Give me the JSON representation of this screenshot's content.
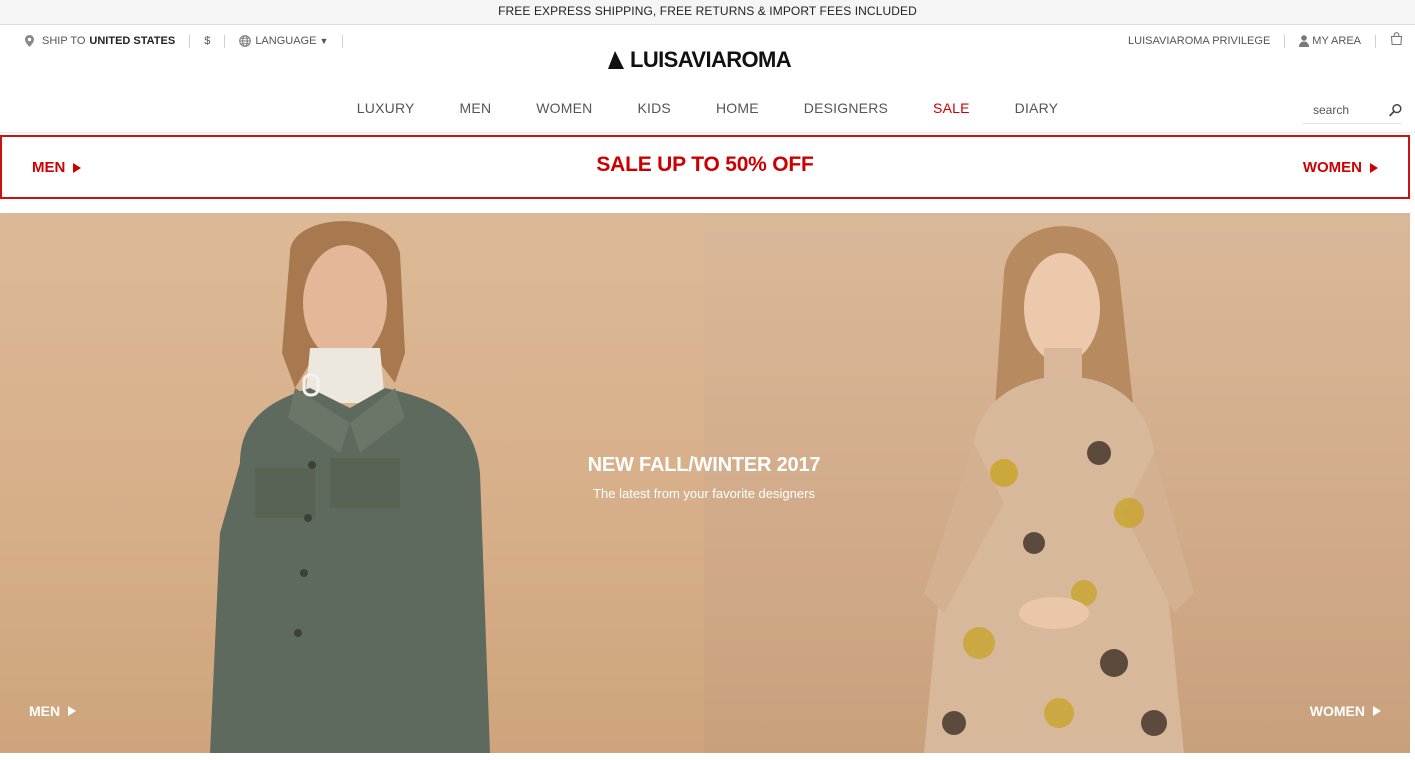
{
  "promo": {
    "text": "FREE EXPRESS SHIPPING, FREE RETURNS & IMPORT FEES INCLUDED"
  },
  "utility": {
    "ship_to_label": "SHIP TO",
    "ship_to_country": "UNITED STATES",
    "currency": "$",
    "language": "LANGUAGE",
    "privilege": "LUISAVIAROMA PRIVILEGE",
    "my_area": "MY AREA"
  },
  "logo": {
    "text": "LUISAVIAROMA"
  },
  "nav": {
    "items": [
      {
        "label": "LUXURY"
      },
      {
        "label": "MEN"
      },
      {
        "label": "WOMEN"
      },
      {
        "label": "KIDS"
      },
      {
        "label": "HOME"
      },
      {
        "label": "DESIGNERS"
      },
      {
        "label": "SALE"
      },
      {
        "label": "DIARY"
      }
    ]
  },
  "search": {
    "placeholder": "search"
  },
  "sale_banner": {
    "title": "SALE UP TO 50% OFF",
    "left_link": "MEN",
    "right_link": "WOMEN"
  },
  "hero": {
    "title": "NEW FALL/WINTER 2017",
    "subtitle": "The latest from your favorite designers",
    "left_link": "MEN",
    "right_link": "WOMEN"
  },
  "colors": {
    "accent_red": "#cc0000",
    "hero_bg": "#d8b18c"
  },
  "icons": [
    "location-pin-icon",
    "globe-icon",
    "user-icon",
    "shopping-bag-icon",
    "search-icon",
    "play-triangle-icon"
  ]
}
